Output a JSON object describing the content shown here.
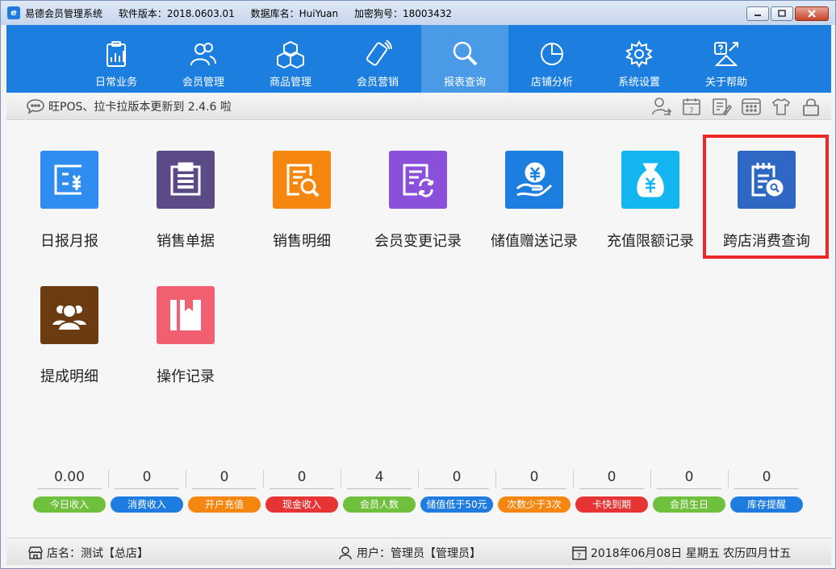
{
  "titlebar": {
    "app_name": "易德会员管理系统",
    "version": "软件版本：2018.0603.01",
    "database": "数据库名：HuiYuan",
    "dongle": "加密狗号：18003432"
  },
  "nav": [
    {
      "label": "日常业务",
      "icon": "clipboard-chart-icon"
    },
    {
      "label": "会员管理",
      "icon": "members-icon"
    },
    {
      "label": "商品管理",
      "icon": "boxes-icon"
    },
    {
      "label": "会员营销",
      "icon": "phone-icon"
    },
    {
      "label": "报表查询",
      "icon": "magnifier-icon"
    },
    {
      "label": "店铺分析",
      "icon": "pie-chart-icon"
    },
    {
      "label": "系统设置",
      "icon": "gear-icon"
    },
    {
      "label": "关于帮助",
      "icon": "help-icon"
    }
  ],
  "notice": {
    "text": "旺POS、拉卡拉版本更新到 2.4.6 啦"
  },
  "tiles": [
    {
      "label": "日报月报",
      "color": "#2f8df0",
      "icon": "daily-report-icon"
    },
    {
      "label": "销售单据",
      "color": "#5b4a86",
      "icon": "sales-doc-icon"
    },
    {
      "label": "销售明细",
      "color": "#f5860f",
      "icon": "sales-detail-icon"
    },
    {
      "label": "会员变更记录",
      "color": "#8a50d9",
      "icon": "member-change-icon"
    },
    {
      "label": "储值赠送记录",
      "color": "#1c7fe0",
      "icon": "stored-value-gift-icon"
    },
    {
      "label": "充值限额记录",
      "color": "#14b6f2",
      "icon": "money-bag-icon"
    },
    {
      "label": "跨店消费查询",
      "color": "#2f67c4",
      "icon": "cross-store-query-icon"
    },
    {
      "label": "提成明细",
      "color": "#6b3c12",
      "icon": "commission-icon"
    },
    {
      "label": "操作记录",
      "color": "#f06070",
      "icon": "operation-log-icon"
    }
  ],
  "stats": [
    {
      "value": "0.00",
      "label": "今日收入",
      "color": "#6fc03c"
    },
    {
      "value": "0",
      "label": "消费收入",
      "color": "#1e7be0"
    },
    {
      "value": "0",
      "label": "开户充值",
      "color": "#f5860f"
    },
    {
      "value": "0",
      "label": "现金收入",
      "color": "#e63434"
    },
    {
      "value": "4",
      "label": "会员人数",
      "color": "#6fc03c"
    },
    {
      "value": "0",
      "label": "储值低于50元",
      "color": "#1e7be0"
    },
    {
      "value": "0",
      "label": "次数少于3次",
      "color": "#f5860f"
    },
    {
      "value": "0",
      "label": "卡快到期",
      "color": "#e63434"
    },
    {
      "value": "0",
      "label": "会员生日",
      "color": "#6fc03c"
    },
    {
      "value": "0",
      "label": "库存提醒",
      "color": "#1e7be0"
    }
  ],
  "status": {
    "store": "店名：测试【总店】",
    "user": "用户：管理员【管理员】",
    "date": "2018年06月08日 星期五 农历四月廿五"
  }
}
